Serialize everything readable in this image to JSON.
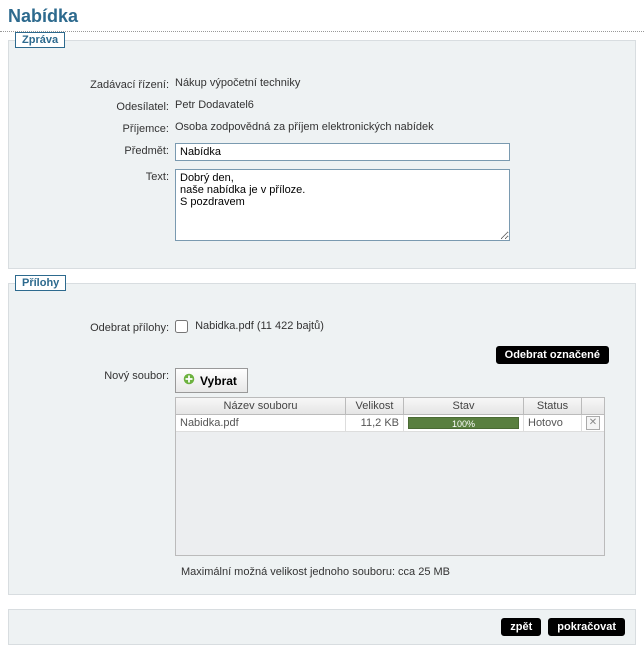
{
  "title": "Nabídka",
  "message": {
    "legend": "Zpráva",
    "rows": {
      "procurement": {
        "label": "Zadávací řízení:",
        "value": "Nákup výpočetní techniky"
      },
      "sender": {
        "label": "Odesílatel:",
        "value": "Petr Dodavatel6"
      },
      "recipient": {
        "label": "Příjemce:",
        "value": "Osoba zodpovědná za příjem elektronických nabídek"
      },
      "subject": {
        "label": "Předmět:",
        "value": "Nabídka"
      },
      "text": {
        "label": "Text:",
        "value": "Dobrý den,\nnaše nabídka je v příloze.\nS pozdravem"
      }
    }
  },
  "attachments": {
    "legend": "Přílohy",
    "remove_label": "Odebrat přílohy:",
    "file_label": "Nabidka.pdf (11 422 bajtů)",
    "remove_btn": "Odebrat označené",
    "new_file_label": "Nový soubor:",
    "select_btn": "Vybrat",
    "grid": {
      "headers": {
        "name": "Název souboru",
        "size": "Velikost",
        "state": "Stav",
        "status": "Status"
      },
      "rows": [
        {
          "name": "Nabidka.pdf",
          "size": "11,2 KB",
          "progress": "100%",
          "status": "Hotovo"
        }
      ]
    },
    "hint": "Maximální možná velikost jednoho souboru: cca 25 MB"
  },
  "footer": {
    "back": "zpět",
    "continue": "pokračovat"
  }
}
